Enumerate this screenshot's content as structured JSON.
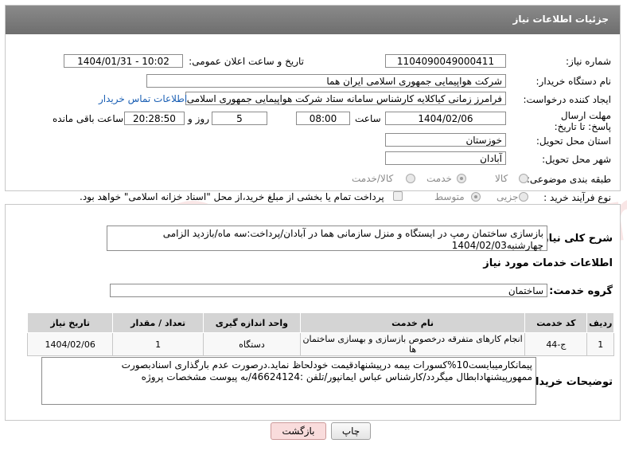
{
  "header": {
    "title": "جزئیات اطلاعات نیاز"
  },
  "fields": {
    "need_number_label": "شماره نیاز:",
    "need_number": "1104090049000411",
    "announce_label": "تاریخ و ساعت اعلان عمومی:",
    "announce_value": "1404/01/31 - 10:02",
    "buyer_label": "نام دستگاه خریدار:",
    "buyer_value": "شرکت هواپیمایی جمهوری اسلامی ایران هما",
    "creator_label": "ایجاد کننده درخواست:",
    "creator_value": "فرامرز زمانی کیاکلایه کارشناس سامانه ستاد شرکت هواپیمایی جمهوری اسلامی",
    "contact_link": "اطلاعات تماس خریدار",
    "deadline_label": "مهلت ارسال پاسخ: تا تاریخ:",
    "deadline_date": "1404/02/06",
    "time_label": "ساعت",
    "deadline_time": "08:00",
    "days_value": "5",
    "days_label": "روز و",
    "remaining_time": "20:28:50",
    "remaining_label": "ساعت باقی مانده",
    "province_label": "استان محل تحویل:",
    "province_value": "خوزستان",
    "city_label": "شهر محل تحویل:",
    "city_value": "آبادان",
    "category_label": "طبقه بندی موضوعی:",
    "category_options": [
      "کالا",
      "خدمت",
      "کالا/خدمت"
    ],
    "process_label": "نوع فرآیند خرید :",
    "process_options": [
      "جزیی",
      "متوسط"
    ],
    "payment_note": "پرداخت تمام یا بخشی از مبلغ خرید،از محل \"اسناد خزانه اسلامی\" خواهد بود."
  },
  "description": {
    "label": "شرح کلی نیاز:",
    "text": "بازسازی ساختمان رمپ در ایستگاه و منزل سازمانی هما در آبادان/پرداخت:سه ماه/بازدید الزامی چهارشنبه1404/02/03"
  },
  "services": {
    "section_title": "اطلاعات خدمات مورد نیاز",
    "group_label": "گروه خدمت:",
    "group_value": "ساختمان",
    "columns": [
      "ردیف",
      "کد خدمت",
      "نام خدمت",
      "واحد اندازه گیری",
      "تعداد / مقدار",
      "تاریخ نیاز"
    ],
    "rows": [
      [
        "1",
        "ج-44",
        "انجام کارهای متفرقه درخصوص بازسازی و بهسازی ساختمان ها",
        "دستگاه",
        "1",
        "1404/02/06"
      ]
    ]
  },
  "buyer_notes": {
    "label": "توضیحات خریدار:",
    "text": "پیمانکارمیبایست10%کسورات بیمه درپیشنهادقیمت خودلحاظ نماید.درصورت عدم بارگذاری اسنادبصورت ممهورپیشنهادابطال میگردد/کارشناس عباس ایمانپور/تلفن :46624124/به پیوست مشخصات پروژه"
  },
  "buttons": {
    "print": "چاپ",
    "back": "بازگشت"
  },
  "watermark": "AriaTender.net"
}
